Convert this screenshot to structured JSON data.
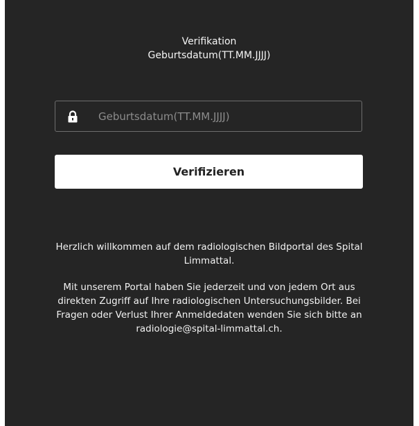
{
  "verification": {
    "title": "Verifikation",
    "subtitle": "Geburtsdatum(TT.MM.JJJJ)"
  },
  "birthdate_field": {
    "icon": "lock-icon",
    "value": "",
    "placeholder": "Geburtsdatum(TT.MM.JJJJ)"
  },
  "verify_button": {
    "label": "Verifizieren"
  },
  "welcome": {
    "greeting": "Herzlich willkommen auf dem radiologischen Bildportal des Spital Limmattal.",
    "info": "Mit unserem Portal haben Sie jederzeit und von jedem Ort aus direkten Zugriff auf Ihre radiologischen Untersuchungsbilder. Bei Fragen oder Verlust Ihrer Anmeldedaten wenden Sie sich bitte an",
    "email": "radiologie@spital-limmattal.ch."
  },
  "colors": {
    "panel_background": "#252525",
    "button_background": "#ffffff",
    "text": "#f2f2f2"
  }
}
